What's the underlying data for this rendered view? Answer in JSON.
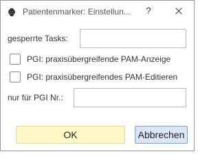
{
  "window": {
    "title": "Patientenmarker: Einstellun...",
    "help_label": "?"
  },
  "form": {
    "blocked_tasks_label": "gesperrte Tasks:",
    "blocked_tasks_value": "",
    "pgi_display_label": "PGI: praxisübergreifende PAM-Anzeige",
    "pgi_display_checked": false,
    "pgi_edit_label": "PGI: praxisübergreifendes PAM-Editieren",
    "pgi_edit_checked": false,
    "pgi_number_label": "nur für PGI Nr.:",
    "pgi_number_value": ""
  },
  "buttons": {
    "ok_label": "OK",
    "cancel_label": "Abbrechen"
  },
  "colors": {
    "ok_background": "#fff8c6",
    "cancel_background": "#dbe6f5",
    "cancel_border": "#7f9fc8"
  },
  "icons": {
    "app": "strawberry-icon",
    "close": "close-icon"
  }
}
